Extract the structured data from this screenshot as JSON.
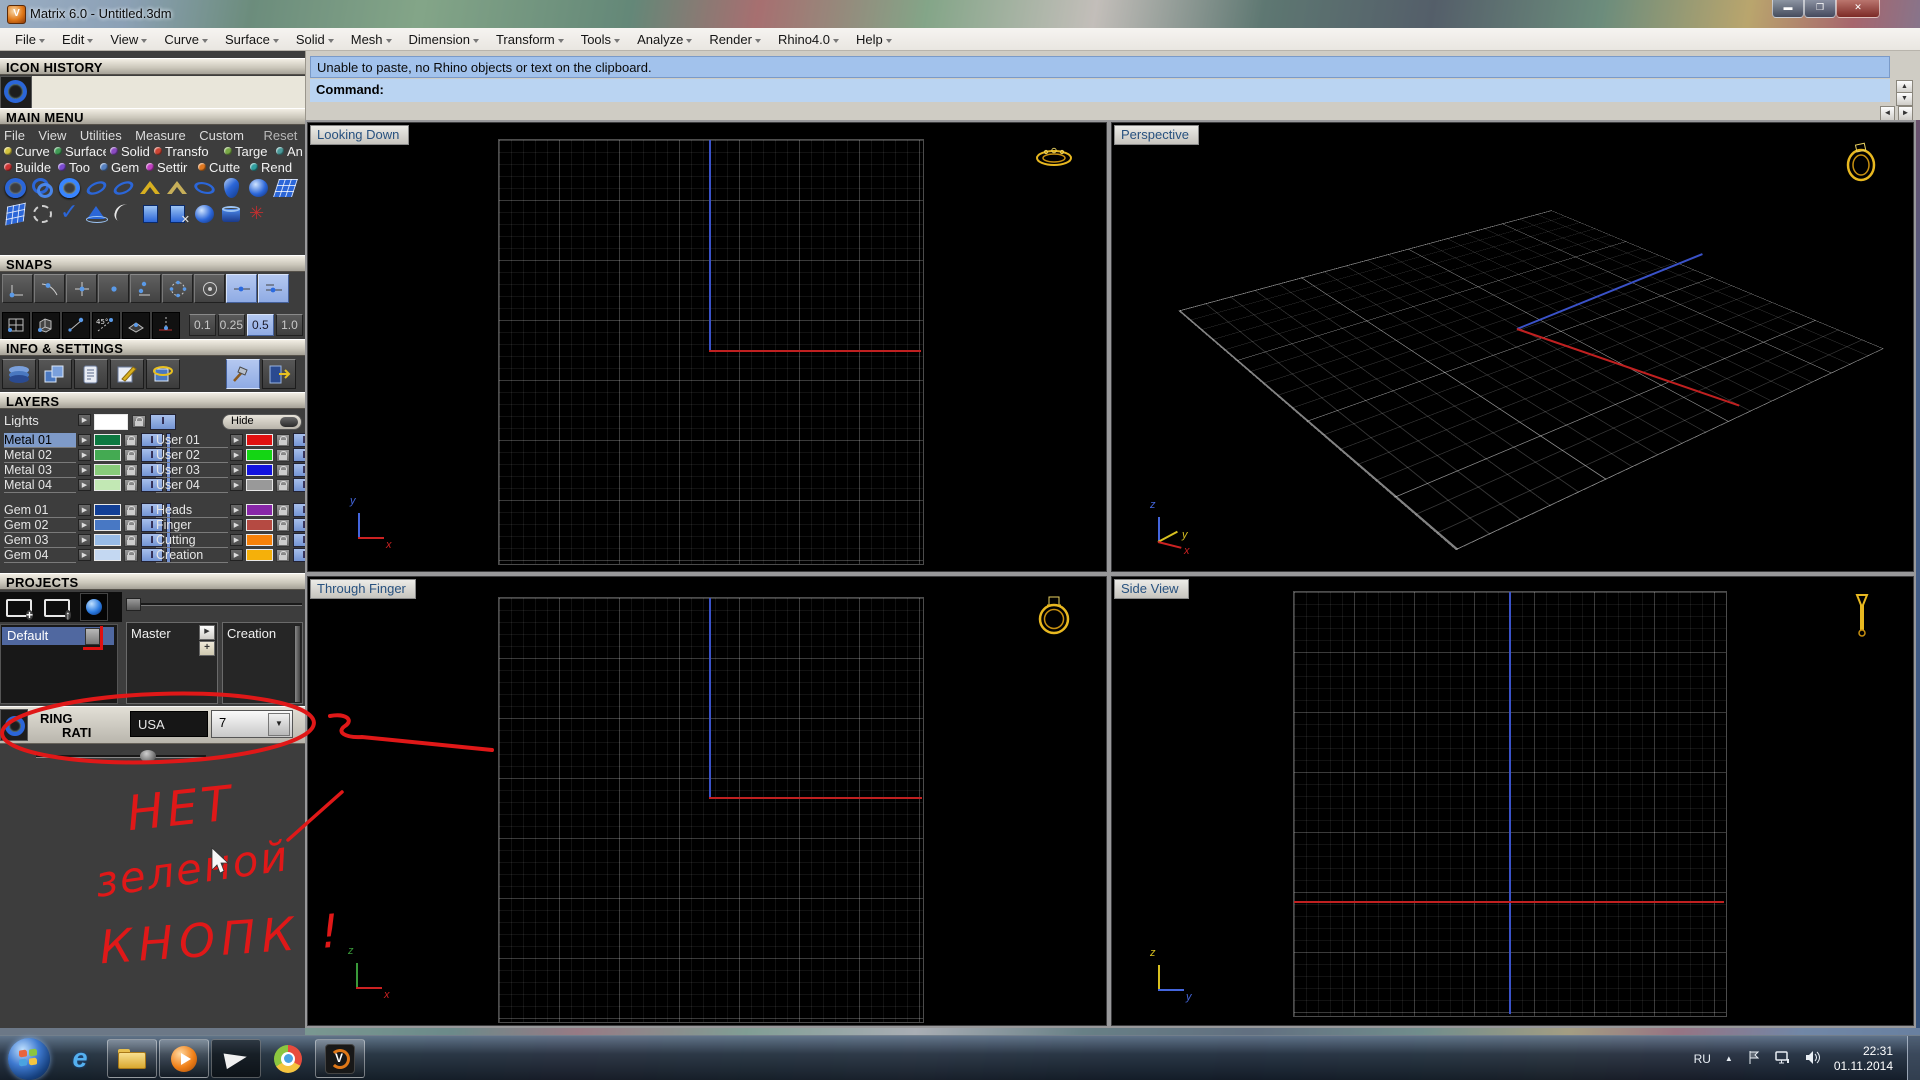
{
  "window": {
    "title": "Matrix 6.0 - Untitled.3dm"
  },
  "icons": {
    "minimize": "▬",
    "maximize": "❒",
    "close": "✕",
    "spin_up": "▲",
    "spin_down": "▼",
    "nav_left": "◄",
    "nav_right": "►",
    "dropdown": "▼",
    "expand": "▶",
    "toggle_i": "I",
    "tray_up": "▲",
    "plus": "+"
  },
  "menu": {
    "items": [
      "File",
      "Edit",
      "View",
      "Curve",
      "Surface",
      "Solid",
      "Mesh",
      "Dimension",
      "Transform",
      "Tools",
      "Analyze",
      "Render",
      "Rhino4.0",
      "Help"
    ]
  },
  "command": {
    "history": "Unable to paste, no Rhino objects or text on the clipboard.",
    "label": "Command:"
  },
  "sidebar": {
    "sections": {
      "icon_history": "ICON HISTORY",
      "main_menu": "MAIN MENU",
      "snaps": "SNAPS",
      "info_settings": "INFO & SETTINGS",
      "layers": "LAYERS",
      "projects": "PROJECTS"
    },
    "main_menu": {
      "tabs": [
        "File",
        "View",
        "Utilities",
        "Measure",
        "Custom"
      ],
      "reset": "Reset",
      "row1": [
        {
          "label": "Curve",
          "color": "#d2c23c"
        },
        {
          "label": "Surface",
          "color": "#3f9a55"
        },
        {
          "label": "Solid",
          "color": "#8a4ac0"
        },
        {
          "label": "Transfo",
          "color": "#cc4433"
        },
        {
          "label": "Targe",
          "color": "#78a845"
        },
        {
          "label": "An",
          "color": "#4a9a9a"
        }
      ],
      "row2": [
        {
          "label": "Builde",
          "color": "#cc3333"
        },
        {
          "label": "Too",
          "color": "#7a4ad0"
        },
        {
          "label": "Gem",
          "color": "#5580c0"
        },
        {
          "label": "Settir",
          "color": "#c040c0"
        },
        {
          "label": "Cutte",
          "color": "#e07820"
        },
        {
          "label": "Rend",
          "color": "#30a0a0"
        }
      ]
    },
    "snaps": {
      "values": [
        "0.1",
        "0.25",
        "0.5",
        "1.0"
      ],
      "selected_value": "0.5"
    },
    "layers": {
      "hide_label": "Hide",
      "left": [
        {
          "name": "Lights",
          "color": "#ffffff",
          "selected": false
        },
        {
          "name": "Metal 01",
          "color": "#0c7840",
          "selected": true
        },
        {
          "name": "Metal 02",
          "color": "#44aa52",
          "selected": false
        },
        {
          "name": "Metal 03",
          "color": "#88cc7a",
          "selected": false
        },
        {
          "name": "Metal 04",
          "color": "#c2e8b4",
          "selected": false
        },
        {
          "name": "Gem 01",
          "color": "#123f96",
          "selected": false
        },
        {
          "name": "Gem 02",
          "color": "#4878c4",
          "selected": false
        },
        {
          "name": "Gem 03",
          "color": "#98bce8",
          "selected": false
        },
        {
          "name": "Gem 04",
          "color": "#c4d8f2",
          "selected": false
        }
      ],
      "right": [
        {
          "name": "User 01",
          "color": "#e01010"
        },
        {
          "name": "User 02",
          "color": "#14d514"
        },
        {
          "name": "User 03",
          "color": "#1212dd"
        },
        {
          "name": "User 04",
          "color": "#999999"
        },
        {
          "name": "Heads",
          "color": "#8826a8"
        },
        {
          "name": "Finger",
          "color": "#b54a42"
        },
        {
          "name": "Cutting",
          "color": "#f78108"
        },
        {
          "name": "Creation",
          "color": "#f5b00a"
        }
      ]
    },
    "projects": {
      "selected_item": "Default",
      "panel1": "Master",
      "panel2": "Creation"
    },
    "ring": {
      "title": "RING",
      "subtitle": "RATI",
      "standard": "USA",
      "size": "7"
    }
  },
  "viewports": {
    "top_left": "Looking Down",
    "top_right": "Perspective",
    "bottom_left": "Through Finger",
    "bottom_right": "Side View"
  },
  "annotation": {
    "color": "#e01818",
    "line1": "НЕТ",
    "line2": "зеленой",
    "line3": "КНОПК !"
  },
  "taskbar": {
    "tray": {
      "language": "RU",
      "time": "22:31",
      "date": "01.11.2014"
    }
  }
}
